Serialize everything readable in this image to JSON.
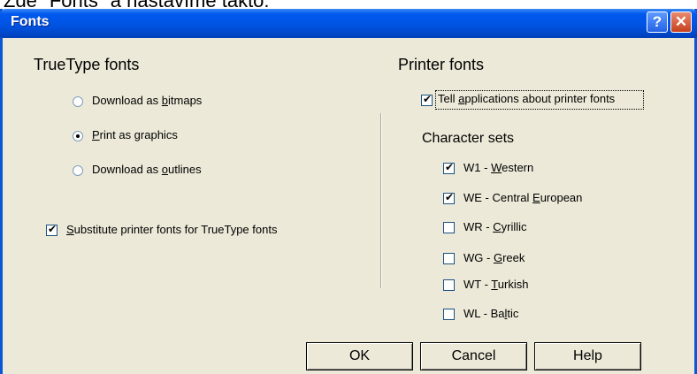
{
  "background_text": "Zde \"Fonts\" a nastavíme takto:",
  "window": {
    "title": "Fonts",
    "help_glyph": "?",
    "close_glyph": "✕"
  },
  "truetype": {
    "heading": "TrueType fonts",
    "options": [
      {
        "pre": "Download as ",
        "key": "b",
        "post": "itmaps",
        "selected": false
      },
      {
        "pre": "",
        "key": "P",
        "post": "rint as graphics",
        "selected": true
      },
      {
        "pre": "Download as ",
        "key": "o",
        "post": "utlines",
        "selected": false
      }
    ],
    "substitute": {
      "pre": "",
      "key": "S",
      "post": "ubstitute printer fonts for TrueType fonts",
      "checked": true
    }
  },
  "printer": {
    "heading": "Printer fonts",
    "tell": {
      "pre": "Tell ",
      "key": "a",
      "post": "pplications about printer fonts",
      "checked": true
    },
    "charsets_heading": "Character sets",
    "charsets": [
      {
        "pre": "W1 - ",
        "key": "W",
        "post": "estern",
        "checked": true
      },
      {
        "pre": "WE - Central ",
        "key": "E",
        "post": "uropean",
        "checked": true
      },
      {
        "pre": "WR - ",
        "key": "C",
        "post": "yrillic",
        "checked": false
      },
      {
        "pre": "WG - ",
        "key": "G",
        "post": "reek",
        "checked": false
      },
      {
        "pre": "WT - ",
        "key": "T",
        "post": "urkish",
        "checked": false
      },
      {
        "pre": "WL - Ba",
        "key": "l",
        "post": "tic",
        "checked": false
      }
    ]
  },
  "buttons": {
    "ok": "OK",
    "cancel": "Cancel",
    "help": "Help"
  }
}
